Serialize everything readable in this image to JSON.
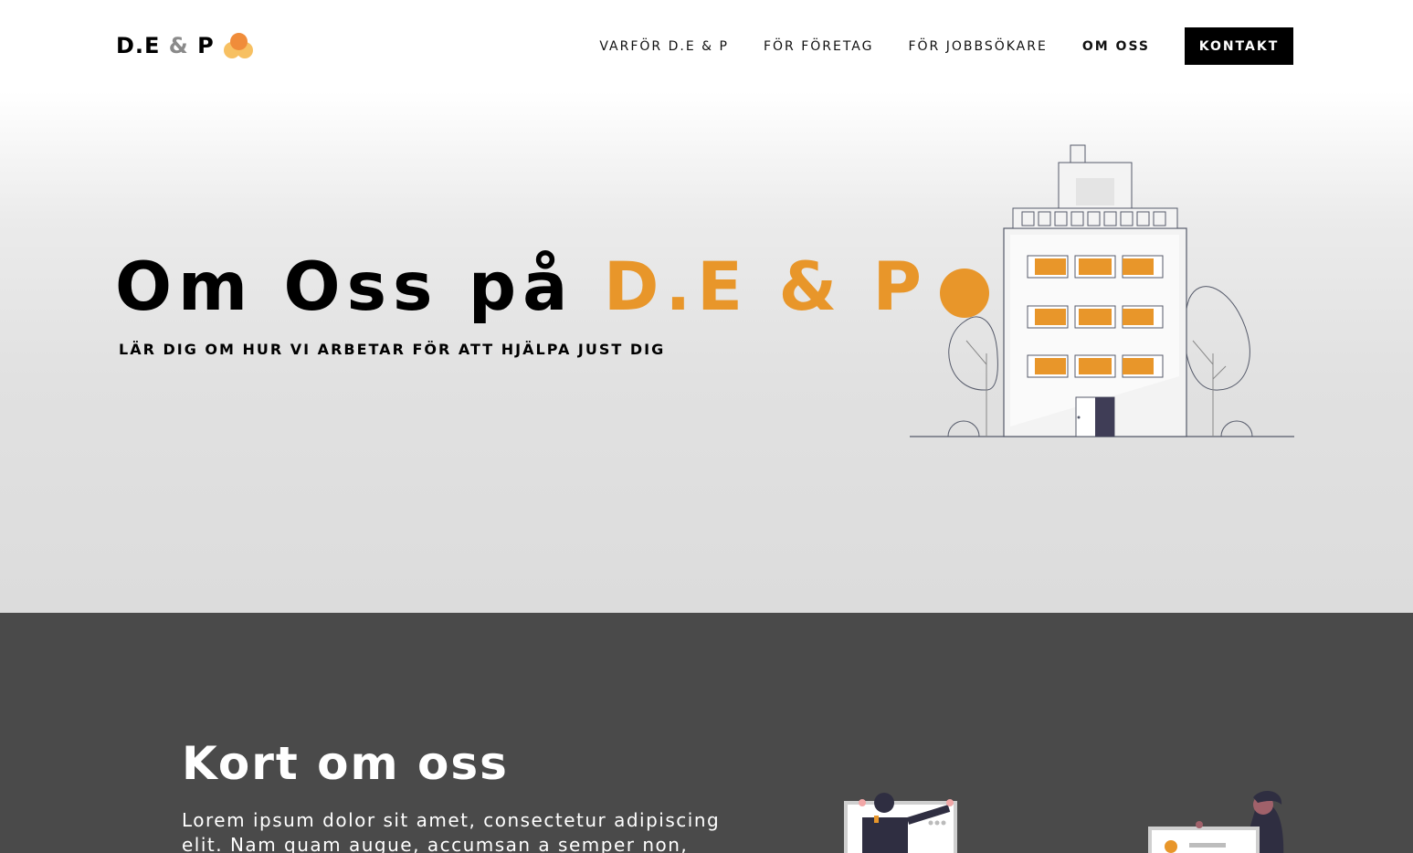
{
  "header": {
    "logo": {
      "part1": "D.E",
      "amp": "&",
      "part2": "P"
    },
    "nav": [
      {
        "label": "VARFÖR D.E & P",
        "active": false
      },
      {
        "label": "FÖR FÖRETAG",
        "active": false
      },
      {
        "label": "FÖR JOBBSÖKARE",
        "active": false
      },
      {
        "label": "OM OSS",
        "active": true
      }
    ],
    "cta": "KONTAKT"
  },
  "hero": {
    "title_main": "Om Oss på ",
    "title_accent": "D.E & P",
    "subtitle": "LÄR DIG OM HUR VI ARBETAR FÖR ATT HJÄLPA JUST DIG",
    "illustration_icon": "office-building-icon"
  },
  "about": {
    "title": "Kort om oss",
    "text": "Lorem ipsum dolor sit amet, consectetur adipiscing elit. Nam quam augue, accumsan a semper non,"
  },
  "colors": {
    "accent": "#e8962a",
    "dark_section": "#4a4a4a",
    "hero_bg": "#dcdcdc",
    "cta_bg": "#000000"
  }
}
